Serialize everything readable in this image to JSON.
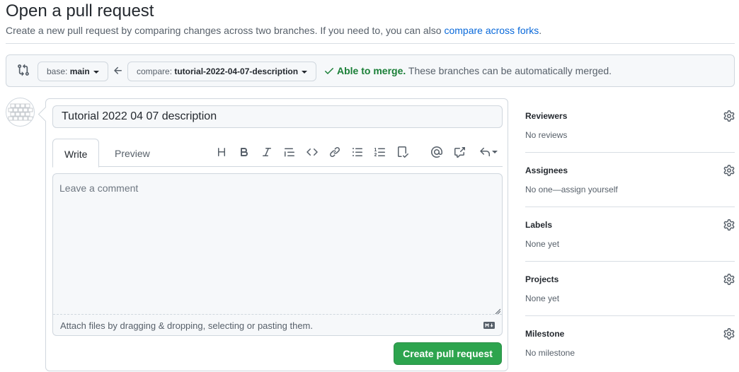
{
  "header": {
    "title": "Open a pull request",
    "subtitle_prefix": "Create a new pull request by comparing changes across two branches. If you need to, you can also ",
    "subtitle_link": "compare across forks",
    "subtitle_suffix": "."
  },
  "range": {
    "base_label": "base: ",
    "base_branch": "main",
    "compare_label": "compare: ",
    "compare_branch": "tutorial-2022-04-07-description",
    "merge_ok": "Able to merge.",
    "merge_msg": " These branches can be automatically merged."
  },
  "composer": {
    "title_value": "Tutorial 2022 04 07 description",
    "tabs": {
      "write": "Write",
      "preview": "Preview"
    },
    "placeholder": "Leave a comment",
    "attach_text": "Attach files by dragging & dropping, selecting or pasting them.",
    "submit_label": "Create pull request"
  },
  "sidebar": {
    "reviewers": {
      "heading": "Reviewers",
      "value": "No reviews"
    },
    "assignees": {
      "heading": "Assignees",
      "value": "No one—assign yourself"
    },
    "labels": {
      "heading": "Labels",
      "value": "None yet"
    },
    "projects": {
      "heading": "Projects",
      "value": "None yet"
    },
    "milestone": {
      "heading": "Milestone",
      "value": "No milestone"
    }
  },
  "colors": {
    "link": "#0969da",
    "success": "#1a7f37",
    "primary_button": "#2da44e"
  },
  "icons": [
    "git-compare-icon",
    "arrow-left-icon",
    "check-icon",
    "heading-icon",
    "bold-icon",
    "italic-icon",
    "quote-icon",
    "code-icon",
    "link-icon",
    "unordered-list-icon",
    "ordered-list-icon",
    "task-list-icon",
    "mention-icon",
    "cross-reference-icon",
    "reply-icon",
    "markdown-icon",
    "gear-icon"
  ]
}
